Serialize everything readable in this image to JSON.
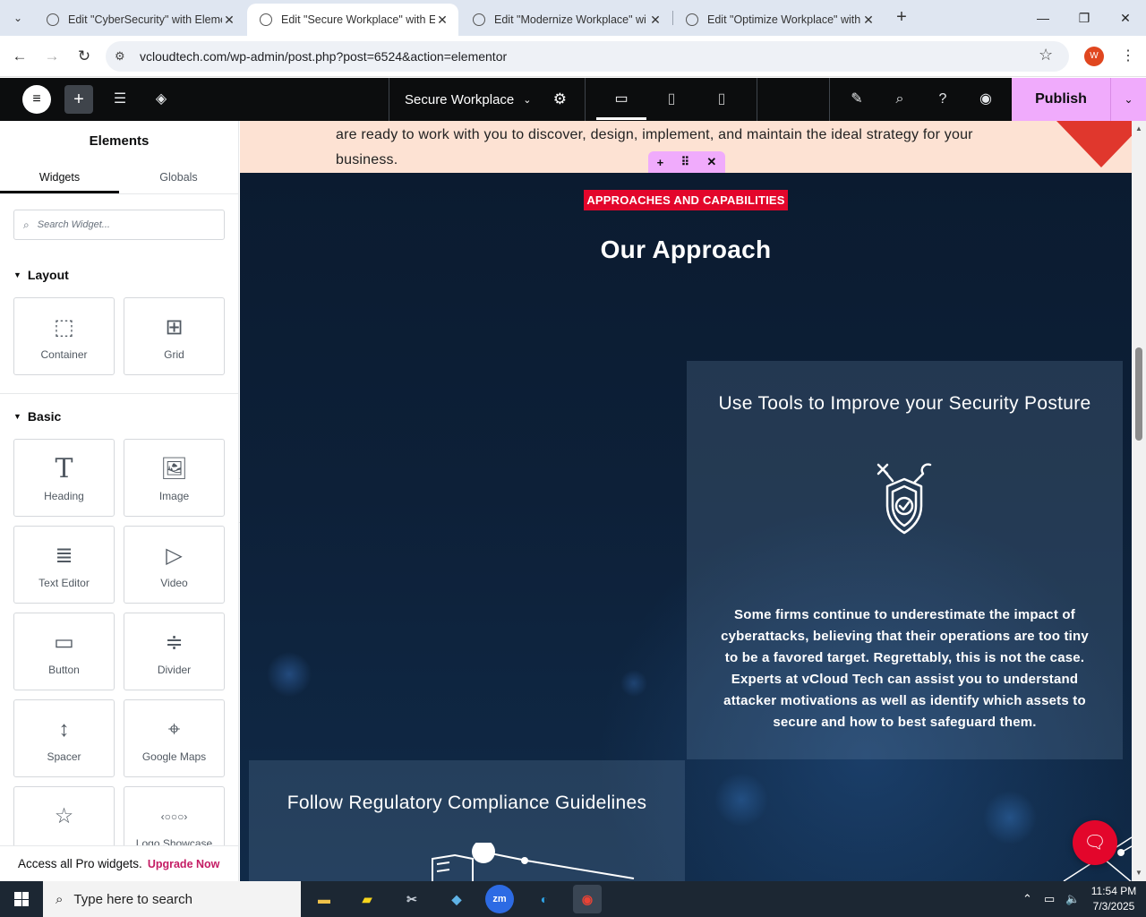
{
  "browser": {
    "tabs": [
      {
        "title": "Edit \"CyberSecurity\" with Eleme",
        "active": false
      },
      {
        "title": "Edit \"Secure Workplace\" with El",
        "active": true
      },
      {
        "title": "Edit \"Modernize Workplace\" wi",
        "active": false
      },
      {
        "title": "Edit \"Optimize Workplace\" with",
        "active": false
      }
    ],
    "new_tab": "+",
    "url": "vcloudtech.com/wp-admin/post.php?post=6524&action=elementor",
    "profile_initial": "W"
  },
  "editor": {
    "page_name": "Secure Workplace",
    "publish_label": "Publish"
  },
  "panel": {
    "title": "Elements",
    "tabs": [
      "Widgets",
      "Globals"
    ],
    "search_placeholder": "Search Widget...",
    "layout_title": "Layout",
    "layout_widgets": [
      {
        "label": "Container",
        "icon": "container-icon"
      },
      {
        "label": "Grid",
        "icon": "grid-icon"
      }
    ],
    "basic_title": "Basic",
    "basic_widgets": [
      {
        "label": "Heading",
        "icon": "heading-icon"
      },
      {
        "label": "Image",
        "icon": "image-icon"
      },
      {
        "label": "Text Editor",
        "icon": "text-editor-icon"
      },
      {
        "label": "Video",
        "icon": "video-icon"
      },
      {
        "label": "Button",
        "icon": "button-icon"
      },
      {
        "label": "Divider",
        "icon": "divider-icon"
      },
      {
        "label": "Spacer",
        "icon": "spacer-icon"
      },
      {
        "label": "Google Maps",
        "icon": "map-icon"
      },
      {
        "label": "",
        "icon": "star-icon"
      },
      {
        "label": "Logo Showcase",
        "icon": "logo-showcase-icon"
      }
    ],
    "promo_text": "Access all Pro widgets.",
    "promo_link": "Upgrade Now"
  },
  "canvas": {
    "intro_text": "are ready to work with you to discover, design, implement, and maintain the ideal strategy for your business.",
    "badge": "APPROACHES AND CAPABILITIES",
    "heading": "Our Approach",
    "card1_title": "Use Tools to Improve your Security Posture",
    "card1_text": "Some firms continue to underestimate the impact of cyberattacks, believing that their operations are too tiny to be a favored target. Regrettably, this is not the case. Experts at vCloud Tech can assist you to understand attacker motivations as well as identify which assets to secure and how to best safeguard them.",
    "card2_title": "Follow Regulatory Compliance Guidelines"
  },
  "taskbar": {
    "search_placeholder": "Type here to search",
    "time": "11:54 PM",
    "date": "7/3/2025"
  },
  "colors": {
    "publish": "#f0abfc",
    "badge": "#e3062b",
    "upgrade_link": "#c41c64"
  }
}
